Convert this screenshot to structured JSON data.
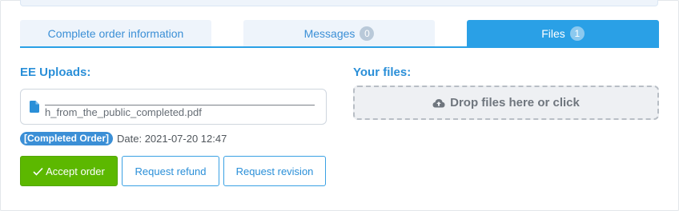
{
  "tabs": [
    {
      "label": "Complete order information",
      "badge": null,
      "active": false
    },
    {
      "label": "Messages",
      "badge": "0",
      "active": false
    },
    {
      "label": "Files",
      "badge": "1",
      "active": true
    }
  ],
  "uploads": {
    "title": "EE Uploads:",
    "file_name": "h_from_the_public_completed.pdf",
    "file_icon": "file-icon",
    "status_badge": "[Completed Order]",
    "date_text": "Date: 2021-07-20 12:47"
  },
  "actions": {
    "accept_label": "Accept order",
    "refund_label": "Request refund",
    "revision_label": "Request revision"
  },
  "your_files": {
    "title": "Your files:",
    "dropzone_label": "Drop files here or click",
    "dropzone_icon": "cloud-upload-icon"
  },
  "colors": {
    "accent": "#2aa0e6",
    "tab_bg": "#eef4fb",
    "accept_green": "#5cb800",
    "badge_blue": "#3b8fd6"
  }
}
